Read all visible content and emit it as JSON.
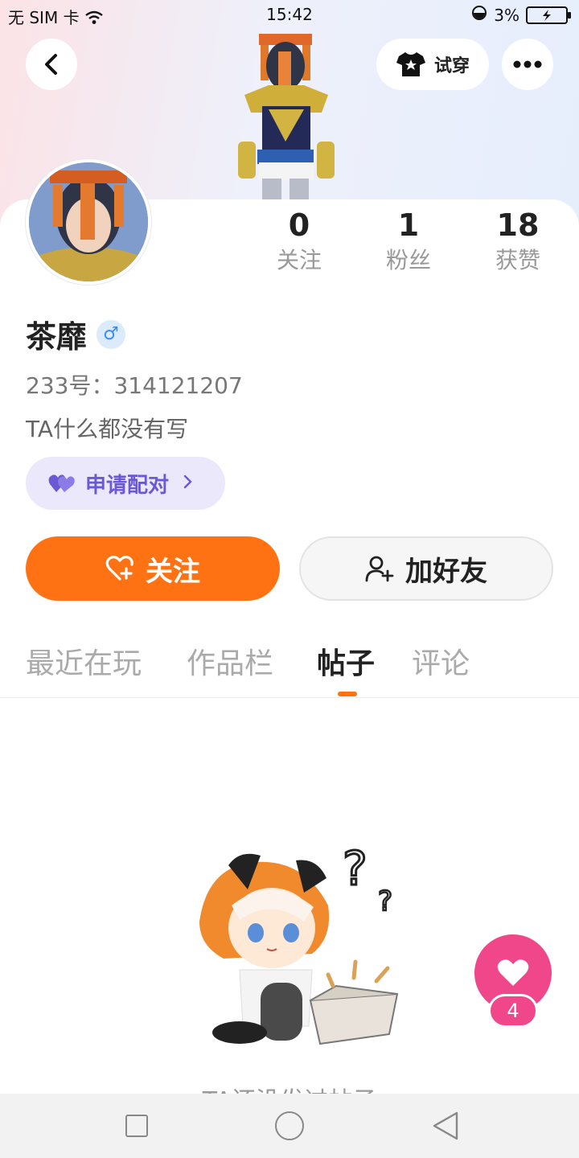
{
  "status_bar": {
    "carrier": "无 SIM 卡",
    "time": "15:42",
    "battery": "3%"
  },
  "header": {
    "try_on_label": "试穿"
  },
  "profile": {
    "name": "茶靡",
    "gender_symbol": "♂",
    "uid": "233号：314121207",
    "bio": "TA什么都没有写",
    "pair_label": "申请配对",
    "stats": [
      {
        "value": "0",
        "label": "关注"
      },
      {
        "value": "1",
        "label": "粉丝"
      },
      {
        "value": "18",
        "label": "获赞"
      }
    ]
  },
  "actions": {
    "follow_label": "关注",
    "add_friend_label": "加好友"
  },
  "tabs": [
    {
      "label": "最近在玩",
      "active": false
    },
    {
      "label": "作品栏",
      "active": false
    },
    {
      "label": "帖子",
      "active": true
    },
    {
      "label": "评论",
      "active": false
    }
  ],
  "empty_state": {
    "text": "TA还没发过帖子"
  },
  "like_fab": {
    "count": "4"
  },
  "colors": {
    "accent_orange": "#ff7214",
    "like_pink": "#f0468a",
    "pair_purple": "#6a58d4"
  }
}
